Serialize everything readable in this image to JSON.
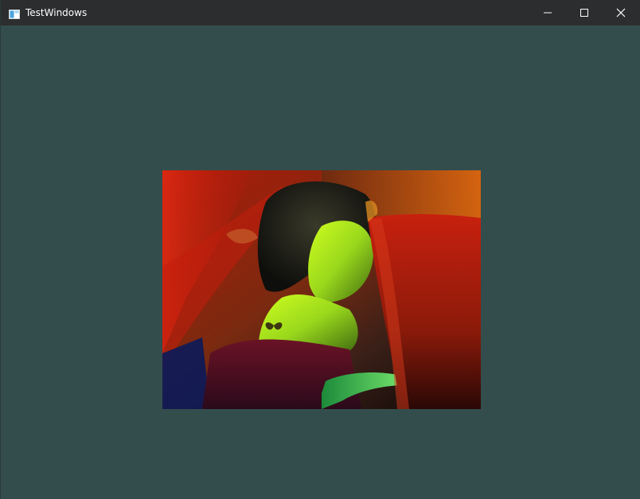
{
  "window": {
    "title": "TestWindows",
    "background_color": "#334d4d",
    "titlebar_color": "#2b2d2e"
  },
  "titlebar": {
    "app_icon": "window-app-icon",
    "buttons": [
      {
        "name": "minimize",
        "icon": "minimize-icon"
      },
      {
        "name": "maximize",
        "icon": "maximize-icon"
      },
      {
        "name": "close",
        "icon": "close-icon"
      }
    ]
  },
  "content": {
    "image": "photo-of-woman-in-red-robes-color-gradient-tinted"
  }
}
